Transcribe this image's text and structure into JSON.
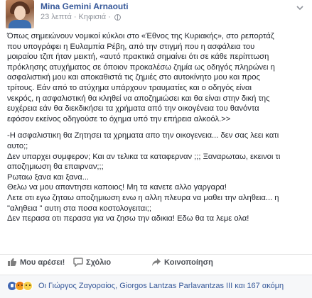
{
  "post": {
    "author": "Mina Gemini Arnaouti",
    "time": "23 λεπτά",
    "separator": "·",
    "location": "Κηφισιά",
    "paragraph1": "Όπως σημειώνουν νομικοί κύκλοι στο «Έθνος της Κυριακής», στο ρεπορτάζ\nπου υπογράφει η Ευλαμπία Ρέβη, από την στιγμή που η ασφάλεια του\nμοιραίου τζιπ ήταν μεικτή, «αυτό πρακτικά σημαίνει ότι σε κάθε περίπτωση\nπρόκλησης ατυχήματος σε όποιον προκαλέσω ζημία ως οδηγός πληρώνει η\nασφαλιστική μου και αποκαθιστά τις ζημιές στο αυτοκίνητο μου και προς\nτρίτους. Εάν από το ατύχημα υπάρχουν τραυματίες και ο οδηγός είναι\nνεκρός, η ασφαλιστική θα κληθεί να αποζημιώσει και θα είναι στην δική της\nευχέρεια εάν θα διεκδικήσει τα χρήματα από την οικογένεια του θανόντα\nεφόσον εκείνος οδηγούσε το όχημα υπό την επήρεια αλκοόλ.>>",
    "paragraph2": "-Η ασφαλιστικη θα Ζητησει τα χρηματα απο την οικογενεια... δεν σας λεει κατι\nαυτο;;\nΔεν υπαρχει συμφερον; Και αν τελικα τα καταφερναν ;;; Ξαναρωταω, εκεινοι τι\nαποζημιωση θα επαιρναν;;;\nΡωταω ξανα και ξανα...\nΘελω να μου απαντησει καποιος! Μη τα κανετε αλλο γαργαρα!\nΛετε οτι εγω ζηταω αποζημιωση ενω η αλλη πλευρα να μαθει την αληθεια... η\n\"αληθεια \" αυτη στα ποσα κοστολογειται;;\nΔεν περασα οτι περασα για να ζησω την αδικια! Εδω θα τα λεμε ολα!"
  },
  "actions": {
    "like": "Μου αρέσει!",
    "comment": "Σχόλιο",
    "share": "Κοινοποίηση"
  },
  "reactions": {
    "text": "Οι Γιώργος Ζαγοραίος, Giorgos Lantzas Parlavantzas III και 167 ακόμη"
  },
  "icons": {
    "menu": "chevron-down-icon",
    "privacy": "globe-icon",
    "like": "thumbs-up-icon",
    "comment": "comment-icon",
    "share": "share-icon"
  },
  "colors": {
    "link": "#365899",
    "text": "#1d2129",
    "muted": "#90949c",
    "like_blue": "#4267b2"
  }
}
